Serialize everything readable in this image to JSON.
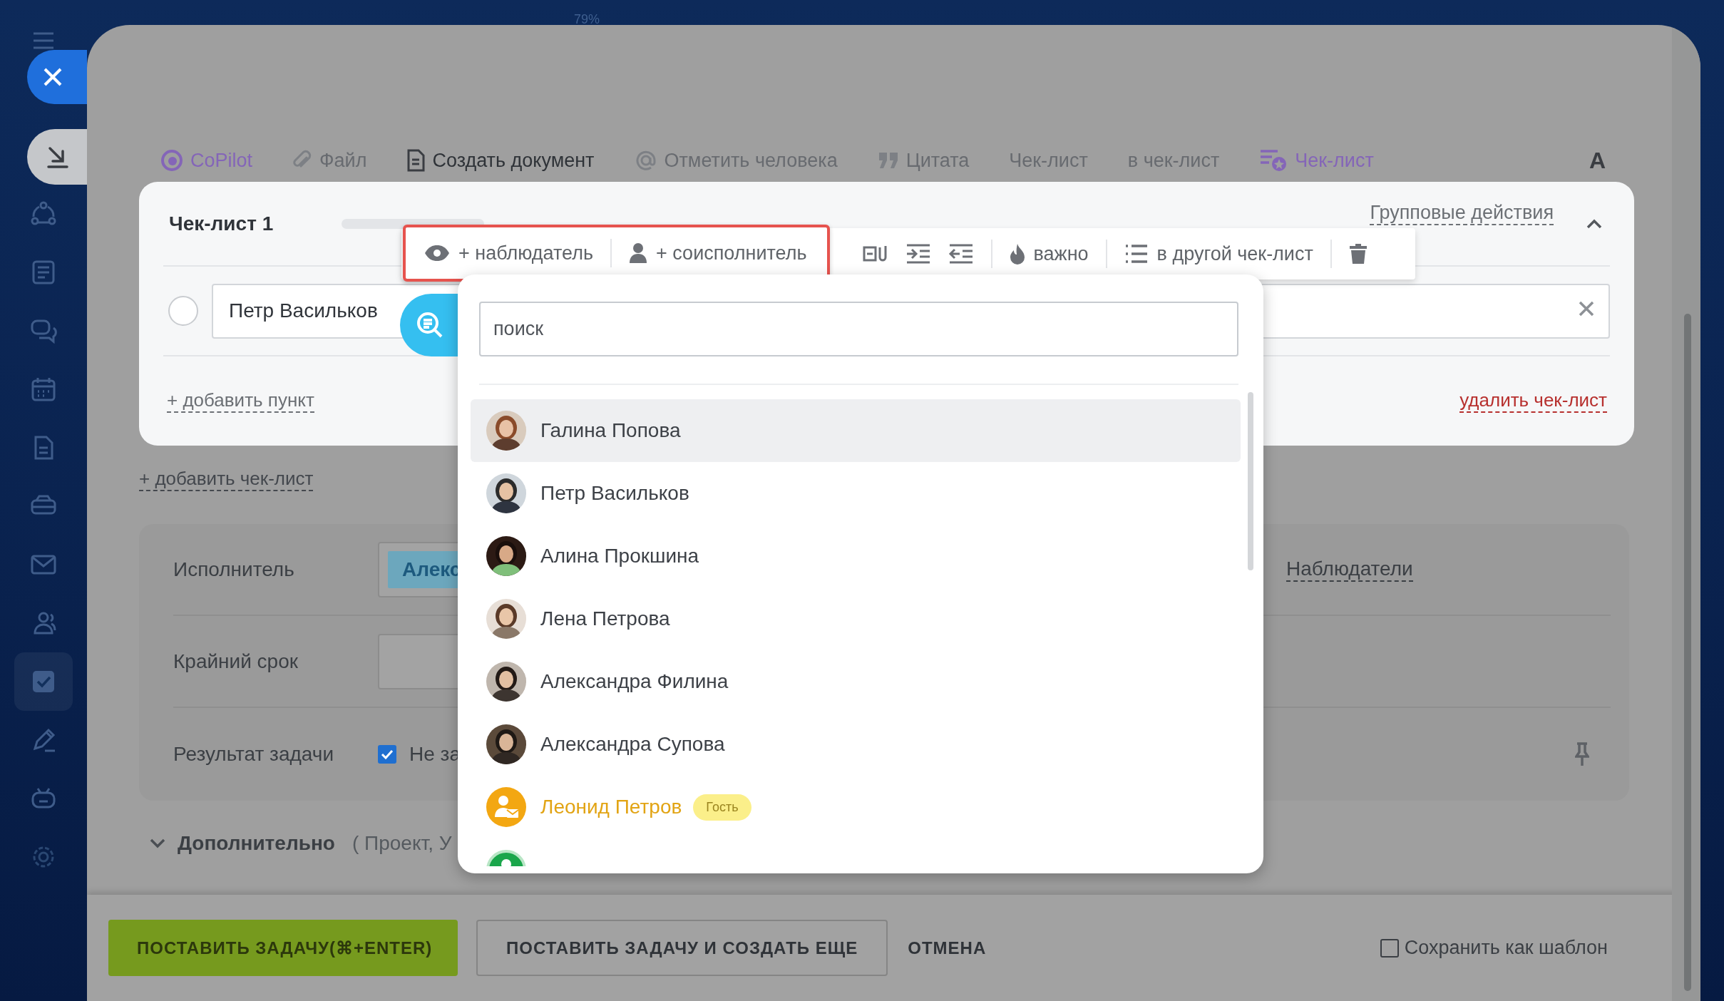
{
  "zoom_label": "79%",
  "sidebar": {
    "items": [
      {
        "kind": "menu",
        "selected": false
      },
      {
        "kind": "download",
        "selected": true
      },
      {
        "kind": "nodes",
        "selected": false
      },
      {
        "kind": "news",
        "selected": false
      },
      {
        "kind": "chat",
        "selected": false
      },
      {
        "kind": "calendar",
        "selected": false
      },
      {
        "kind": "document",
        "selected": false
      },
      {
        "kind": "drive",
        "selected": false
      },
      {
        "kind": "mail",
        "selected": false
      },
      {
        "kind": "people",
        "selected": false
      },
      {
        "kind": "tasks",
        "selected": true
      },
      {
        "kind": "pencil",
        "selected": false
      },
      {
        "kind": "robot",
        "selected": false
      },
      {
        "kind": "gear",
        "selected": false
      }
    ]
  },
  "editor_toolbar": [
    {
      "kind": "copilot",
      "label": "CoPilot",
      "color": "#8465b8"
    },
    {
      "kind": "file",
      "label": "Файл",
      "color": "#686b70"
    },
    {
      "kind": "document",
      "label": "Создать документ",
      "color": "#2f3338"
    },
    {
      "kind": "mention",
      "label": "Отметить человека",
      "color": "#686b70"
    },
    {
      "kind": "quote",
      "label": "Цитата",
      "color": "#686b70"
    },
    {
      "kind": "plain",
      "label": "Чек-лист",
      "color": "#686b70"
    },
    {
      "kind": "plain",
      "label": "в чек-лист",
      "color": "#686b70"
    },
    {
      "kind": "checklist",
      "label": "Чек-лист",
      "color": "#8465b8"
    },
    {
      "kind": "font",
      "label": "A",
      "color": "#3a3d42"
    }
  ],
  "checklist": {
    "title": "Чек-лист 1",
    "progress": {
      "level": 0
    },
    "group_actions": "Групповые действия",
    "expanded": true,
    "items": [
      {
        "text": "Петр Васильков",
        "checked": false
      }
    ],
    "add_item": "+ добавить пункт",
    "delete": "удалить чек-лист"
  },
  "item_toolbar": {
    "highlighted_actions": [
      {
        "kind": "observer",
        "label": "+ наблюдатель"
      },
      {
        "kind": "coexecutor",
        "label": "+ соисполнитель"
      }
    ],
    "actions": [
      {
        "kind": "attach"
      },
      {
        "kind": "indent"
      },
      {
        "kind": "outdent"
      },
      {
        "kind": "important",
        "label": "важно"
      },
      {
        "kind": "move",
        "label": "в другой чек-лист"
      },
      {
        "kind": "delete"
      }
    ]
  },
  "add_checklist": "+ добавить чек-лист",
  "form": {
    "assignee_label": "Исполнитель",
    "assignee_chip": "Алекс",
    "observers_link": "Наблюдатели",
    "deadline_label": "Крайний срок",
    "result_label": "Результат задачи",
    "result_checked": true,
    "result_text": "Не за"
  },
  "more": {
    "label": "Дополнительно",
    "hint": "( Проект, У"
  },
  "footer": {
    "submit": "ПОСТАВИТЬ ЗАДАЧУ(⌘+ENTER)",
    "submit_and_new": "ПОСТАВИТЬ ЗАДАЧУ И СОЗДАТЬ ЕЩЕ",
    "cancel": "ОТМЕНА",
    "save_template": {
      "label": "Сохранить как шаблон",
      "checked": false
    }
  },
  "people_dropdown": {
    "search": {
      "placeholder": "поиск"
    },
    "people": [
      {
        "name": "Галина Попова",
        "selected": true
      },
      {
        "name": "Петр Васильков",
        "selected": false
      },
      {
        "name": "Алина Прокшина",
        "selected": false
      },
      {
        "name": "Лена Петрова",
        "selected": false
      },
      {
        "name": "Александра Филина",
        "selected": false
      },
      {
        "name": "Александра Супова",
        "selected": false
      },
      {
        "kind": "guest",
        "name": "Леонид Петров",
        "badge": "Гость",
        "selected": false
      },
      {
        "kind": "cut_off",
        "selected": false
      }
    ]
  }
}
